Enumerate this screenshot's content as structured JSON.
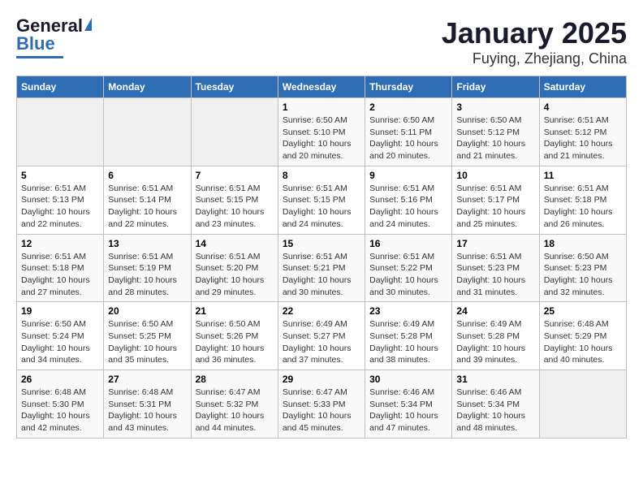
{
  "logo": {
    "line1": "General",
    "line2": "Blue"
  },
  "title": "January 2025",
  "subtitle": "Fuying, Zhejiang, China",
  "headers": [
    "Sunday",
    "Monday",
    "Tuesday",
    "Wednesday",
    "Thursday",
    "Friday",
    "Saturday"
  ],
  "weeks": [
    [
      {
        "day": "",
        "info": ""
      },
      {
        "day": "",
        "info": ""
      },
      {
        "day": "",
        "info": ""
      },
      {
        "day": "1",
        "info": "Sunrise: 6:50 AM\nSunset: 5:10 PM\nDaylight: 10 hours\nand 20 minutes."
      },
      {
        "day": "2",
        "info": "Sunrise: 6:50 AM\nSunset: 5:11 PM\nDaylight: 10 hours\nand 20 minutes."
      },
      {
        "day": "3",
        "info": "Sunrise: 6:50 AM\nSunset: 5:12 PM\nDaylight: 10 hours\nand 21 minutes."
      },
      {
        "day": "4",
        "info": "Sunrise: 6:51 AM\nSunset: 5:12 PM\nDaylight: 10 hours\nand 21 minutes."
      }
    ],
    [
      {
        "day": "5",
        "info": "Sunrise: 6:51 AM\nSunset: 5:13 PM\nDaylight: 10 hours\nand 22 minutes."
      },
      {
        "day": "6",
        "info": "Sunrise: 6:51 AM\nSunset: 5:14 PM\nDaylight: 10 hours\nand 22 minutes."
      },
      {
        "day": "7",
        "info": "Sunrise: 6:51 AM\nSunset: 5:15 PM\nDaylight: 10 hours\nand 23 minutes."
      },
      {
        "day": "8",
        "info": "Sunrise: 6:51 AM\nSunset: 5:15 PM\nDaylight: 10 hours\nand 24 minutes."
      },
      {
        "day": "9",
        "info": "Sunrise: 6:51 AM\nSunset: 5:16 PM\nDaylight: 10 hours\nand 24 minutes."
      },
      {
        "day": "10",
        "info": "Sunrise: 6:51 AM\nSunset: 5:17 PM\nDaylight: 10 hours\nand 25 minutes."
      },
      {
        "day": "11",
        "info": "Sunrise: 6:51 AM\nSunset: 5:18 PM\nDaylight: 10 hours\nand 26 minutes."
      }
    ],
    [
      {
        "day": "12",
        "info": "Sunrise: 6:51 AM\nSunset: 5:18 PM\nDaylight: 10 hours\nand 27 minutes."
      },
      {
        "day": "13",
        "info": "Sunrise: 6:51 AM\nSunset: 5:19 PM\nDaylight: 10 hours\nand 28 minutes."
      },
      {
        "day": "14",
        "info": "Sunrise: 6:51 AM\nSunset: 5:20 PM\nDaylight: 10 hours\nand 29 minutes."
      },
      {
        "day": "15",
        "info": "Sunrise: 6:51 AM\nSunset: 5:21 PM\nDaylight: 10 hours\nand 30 minutes."
      },
      {
        "day": "16",
        "info": "Sunrise: 6:51 AM\nSunset: 5:22 PM\nDaylight: 10 hours\nand 30 minutes."
      },
      {
        "day": "17",
        "info": "Sunrise: 6:51 AM\nSunset: 5:23 PM\nDaylight: 10 hours\nand 31 minutes."
      },
      {
        "day": "18",
        "info": "Sunrise: 6:50 AM\nSunset: 5:23 PM\nDaylight: 10 hours\nand 32 minutes."
      }
    ],
    [
      {
        "day": "19",
        "info": "Sunrise: 6:50 AM\nSunset: 5:24 PM\nDaylight: 10 hours\nand 34 minutes."
      },
      {
        "day": "20",
        "info": "Sunrise: 6:50 AM\nSunset: 5:25 PM\nDaylight: 10 hours\nand 35 minutes."
      },
      {
        "day": "21",
        "info": "Sunrise: 6:50 AM\nSunset: 5:26 PM\nDaylight: 10 hours\nand 36 minutes."
      },
      {
        "day": "22",
        "info": "Sunrise: 6:49 AM\nSunset: 5:27 PM\nDaylight: 10 hours\nand 37 minutes."
      },
      {
        "day": "23",
        "info": "Sunrise: 6:49 AM\nSunset: 5:28 PM\nDaylight: 10 hours\nand 38 minutes."
      },
      {
        "day": "24",
        "info": "Sunrise: 6:49 AM\nSunset: 5:28 PM\nDaylight: 10 hours\nand 39 minutes."
      },
      {
        "day": "25",
        "info": "Sunrise: 6:48 AM\nSunset: 5:29 PM\nDaylight: 10 hours\nand 40 minutes."
      }
    ],
    [
      {
        "day": "26",
        "info": "Sunrise: 6:48 AM\nSunset: 5:30 PM\nDaylight: 10 hours\nand 42 minutes."
      },
      {
        "day": "27",
        "info": "Sunrise: 6:48 AM\nSunset: 5:31 PM\nDaylight: 10 hours\nand 43 minutes."
      },
      {
        "day": "28",
        "info": "Sunrise: 6:47 AM\nSunset: 5:32 PM\nDaylight: 10 hours\nand 44 minutes."
      },
      {
        "day": "29",
        "info": "Sunrise: 6:47 AM\nSunset: 5:33 PM\nDaylight: 10 hours\nand 45 minutes."
      },
      {
        "day": "30",
        "info": "Sunrise: 6:46 AM\nSunset: 5:34 PM\nDaylight: 10 hours\nand 47 minutes."
      },
      {
        "day": "31",
        "info": "Sunrise: 6:46 AM\nSunset: 5:34 PM\nDaylight: 10 hours\nand 48 minutes."
      },
      {
        "day": "",
        "info": ""
      }
    ]
  ]
}
